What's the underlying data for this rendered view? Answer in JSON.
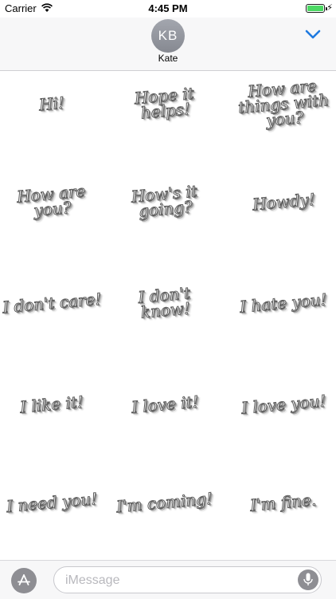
{
  "status_bar": {
    "carrier": "Carrier",
    "time": "4:45 PM",
    "battery_level": 1.0,
    "charging_symbol": "⚡"
  },
  "header": {
    "avatar_initials": "KB",
    "contact_name": "Kate",
    "collapse_icon": "chevron-down-icon"
  },
  "stickers": [
    "Hi!",
    "Hope it helps!",
    "How are things with you?",
    "How are you?",
    "How's it going?",
    "Howdy!",
    "I don't care!",
    "I don't know!",
    "I hate you!",
    "I like it!",
    "I love it!",
    "I love you!",
    "I need you!",
    "I'm coming!",
    "I'm fine."
  ],
  "input_bar": {
    "appstore_icon": "appstore-icon",
    "placeholder": "iMessage",
    "mic_icon": "microphone-icon"
  },
  "colors": {
    "accent": "#1f7ae0",
    "header_bg": "#f7f7f8",
    "avatar_bg": "#8e9097",
    "battery_green": "#4cd964",
    "icon_gray": "#8e8e93"
  }
}
